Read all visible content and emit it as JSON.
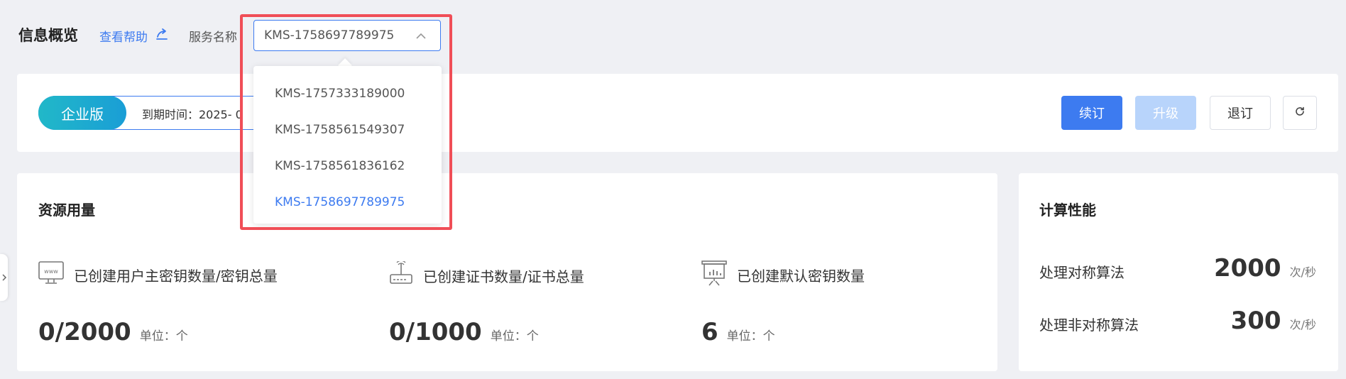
{
  "header": {
    "title": "信息概览",
    "help_label": "查看帮助",
    "service_label": "服务名称",
    "selected_service": "KMS-1758697789975"
  },
  "dropdown": {
    "options": [
      "KMS-1757333189000",
      "KMS-1758561549307",
      "KMS-1758561836162",
      "KMS-1758697789975"
    ],
    "active_index": 3
  },
  "edition": {
    "badge": "企业版",
    "expire_text": "到期时间：2025- 0"
  },
  "actions": {
    "renew": "续订",
    "upgrade": "升级",
    "cancel": "退订"
  },
  "resources": {
    "title": "资源用量",
    "items": [
      {
        "label": "已创建用户主密钥数量/密钥总量",
        "value": "0/2000",
        "unit": "单位：个",
        "icon": "www-monitor-icon"
      },
      {
        "label": "已创建证书数量/证书总量",
        "value": "0/1000",
        "unit": "单位：个",
        "icon": "certificate-device-icon"
      },
      {
        "label": "已创建默认密钥数量",
        "value": "6",
        "unit": "单位：个",
        "icon": "presentation-board-icon"
      }
    ]
  },
  "performance": {
    "title": "计算性能",
    "items": [
      {
        "label": "处理对称算法",
        "value": "2000",
        "unit": "次/秒"
      },
      {
        "label": "处理非对称算法",
        "value": "300",
        "unit": "次/秒"
      }
    ]
  },
  "colors": {
    "accent": "#3d7bf0",
    "highlight": "#f04e57",
    "badge_start": "#21b8c8",
    "badge_end": "#1a9ed6"
  }
}
